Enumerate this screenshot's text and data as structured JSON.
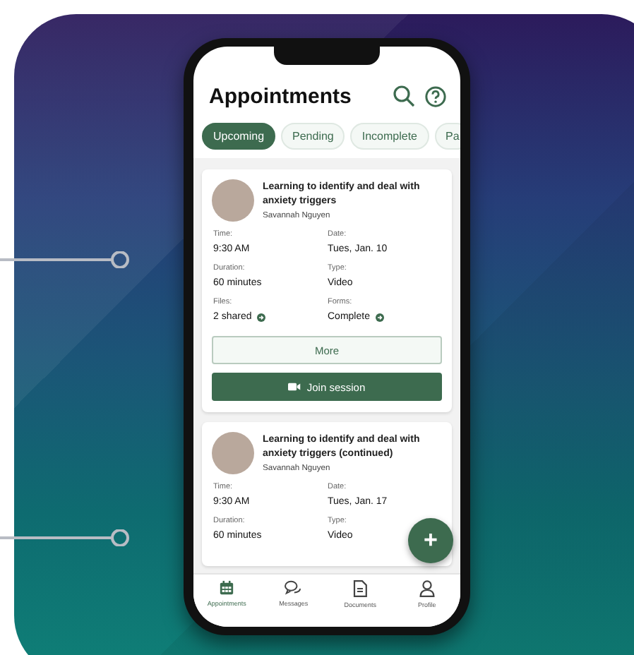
{
  "app": {
    "title": "Appointments"
  },
  "tabs": [
    {
      "label": "Upcoming",
      "selected": true
    },
    {
      "label": "Pending",
      "selected": false
    },
    {
      "label": "Incomplete",
      "selected": false
    },
    {
      "label": "Pa",
      "selected": false
    }
  ],
  "appointments": [
    {
      "title": "Learning to identify and deal with anxiety triggers",
      "provider": "Savannah Nguyen",
      "fields": [
        {
          "label": "Time:",
          "value": "9:30 AM",
          "link": false
        },
        {
          "label": "Date:",
          "value": "Tues, Jan. 10",
          "link": false
        },
        {
          "label": "Duration:",
          "value": "60 minutes",
          "link": false
        },
        {
          "label": "Type:",
          "value": "Video",
          "link": false
        },
        {
          "label": "Files:",
          "value": "2 shared",
          "link": true
        },
        {
          "label": "Forms:",
          "value": "Complete",
          "link": true
        }
      ],
      "buttons": [
        {
          "label": "More",
          "kind": "secondary"
        },
        {
          "label": "Join session",
          "kind": "primary"
        }
      ]
    },
    {
      "title": "Learning to identify and deal with anxiety triggers (continued)",
      "provider": "Savannah Nguyen",
      "fields": [
        {
          "label": "Time:",
          "value": "9:30 AM",
          "link": false
        },
        {
          "label": "Date:",
          "value": "Tues, Jan. 17",
          "link": false
        },
        {
          "label": "Duration:",
          "value": "60 minutes",
          "link": false
        },
        {
          "label": "Type:",
          "value": "Video",
          "link": false
        }
      ]
    }
  ],
  "fab": {
    "label": "+"
  },
  "nav": [
    {
      "label": "Appointments",
      "kind": "calendar",
      "selected": true
    },
    {
      "label": "Messages",
      "kind": "chat",
      "selected": false
    },
    {
      "label": "Documents",
      "kind": "document",
      "selected": false
    },
    {
      "label": "Profile",
      "kind": "person",
      "selected": false
    }
  ]
}
